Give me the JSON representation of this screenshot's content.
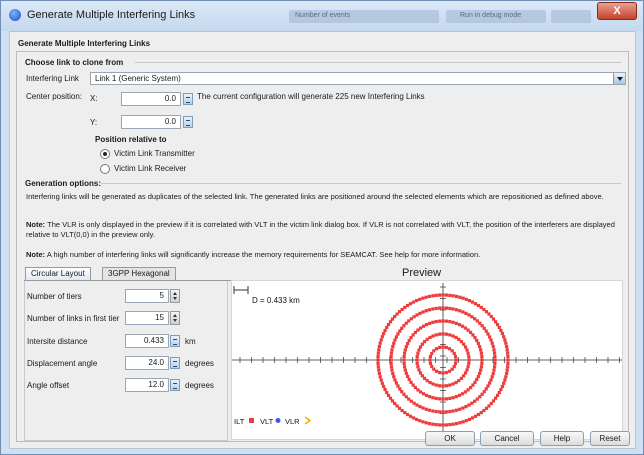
{
  "window": {
    "title": "Generate Multiple Interfering Links",
    "close_glyph": "X",
    "bg_controls": [
      "Number of events",
      "Run in debug mode"
    ]
  },
  "group_title": "Generate Multiple Interfering Links",
  "choose": {
    "header": "Choose link to clone from",
    "interfering_link_label": "Interfering Link",
    "interfering_link_value": "Link 1 (Generic System)",
    "center_position_label": "Center position:",
    "x_label": "X:",
    "x_value": "0.0",
    "y_label": "Y:",
    "y_value": "0.0",
    "config_msg": "The current configuration will generate 225 new Interfering Links",
    "position_relative_label": "Position relative to",
    "radio_transmitter": "Victim Link Transmitter",
    "radio_receiver": "Victim Link Receiver",
    "selected_radio": "transmitter"
  },
  "generation": {
    "header": "Generation options:",
    "para1": "Interfering links will be generated as duplicates of the selected link. The generated links are positioned around the selected elements which are repositioned as defined above.",
    "note_label": "Note:",
    "para2_body": " The VLR is only displayed in the preview if it is correlated with VLT in the victim link dialog box. If VLR is not correlated with VLT, the position of the interferers are displayed relative to VLT(0,0) in the preview only.",
    "para3_body": " A high number of interfering links will significantly increase the memory requirements for SEAMCAT. See help for more information."
  },
  "tabs": [
    {
      "label": "Circular Layout",
      "active": true
    },
    {
      "label": "3GPP Hexagonal",
      "active": false
    }
  ],
  "form": {
    "tiers_label": "Number of tiers",
    "tiers_value": "5",
    "links_label": "Number of links in first tier",
    "links_value": "15",
    "intersite_label": "Intersite distance",
    "intersite_value": "0.433",
    "intersite_unit": "km",
    "displacement_label": "Displacement angle",
    "displacement_value": "24.0",
    "displacement_unit": "degrees",
    "offset_label": "Angle offset",
    "offset_value": "12.0",
    "offset_unit": "degrees"
  },
  "preview": {
    "title": "Preview",
    "distance_label": "D = 0.433 km",
    "legend": [
      {
        "label": "ILT",
        "color": "#ee3b3b"
      },
      {
        "label": "VLT",
        "color": "#3b5bee"
      },
      {
        "label": "VLR",
        "color": "#f0b000"
      }
    ],
    "ilt_color": "#ee3b3b",
    "axis_color": "#333333",
    "tiers": 5,
    "links_first_tier": 15
  },
  "buttons": {
    "ok": "OK",
    "cancel": "Cancel",
    "help": "Help",
    "reset": "Reset"
  },
  "colors": {
    "title_bg": "#cfe0f3",
    "close_red": "#c4442e",
    "dialog_bg": "#eeeeee"
  }
}
